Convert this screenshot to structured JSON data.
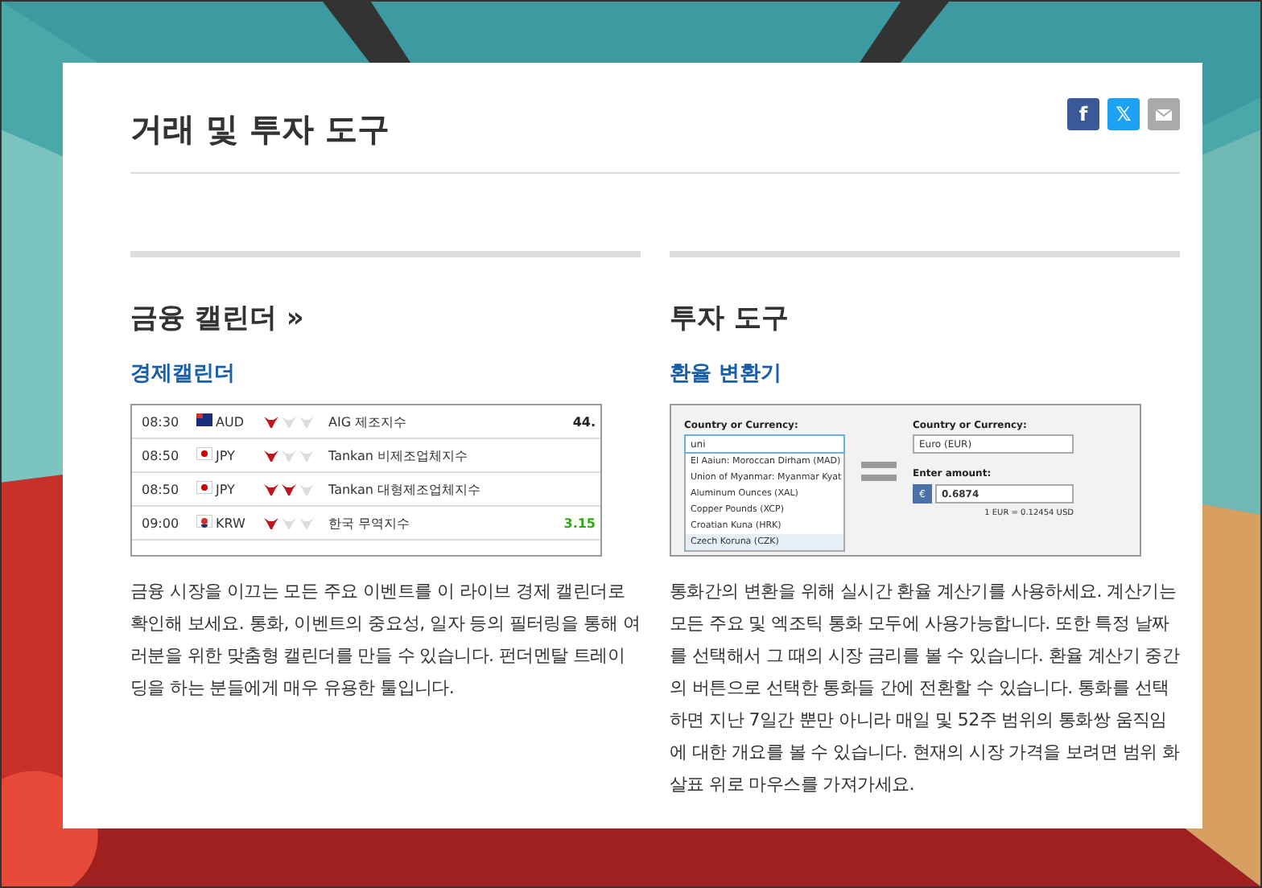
{
  "page": {
    "title": "거래 및 투자 도구"
  },
  "share": [
    {
      "kind": "facebook",
      "label": "f"
    },
    {
      "kind": "x",
      "label": "𝕏"
    },
    {
      "kind": "email"
    }
  ],
  "sections": [
    {
      "kind": "calendar",
      "heading": "금융 캘린더 »",
      "link": "경제캘린더",
      "preview": {
        "rows": [
          {
            "time": "08:30",
            "flag": {
              "kind": "au"
            },
            "currency": "AUD",
            "stars": 1,
            "event": "AIG 제조지수",
            "value": "44.",
            "color": "#222222"
          },
          {
            "time": "08:50",
            "flag": {
              "kind": "jp"
            },
            "currency": "JPY",
            "stars": 1,
            "event": "Tankan 비제조업체지수"
          },
          {
            "time": "08:50",
            "flag": {
              "kind": "jp"
            },
            "currency": "JPY",
            "stars": 2,
            "event": "Tankan 대형제조업체지수"
          },
          {
            "time": "09:00",
            "flag": {
              "kind": "kr"
            },
            "currency": "KRW",
            "stars": 1,
            "event": "한국 무역지수",
            "value": "3.15",
            "color": "#33aa11"
          }
        ]
      },
      "body": "금융 시장을 이끄는 모든 주요 이벤트를 이 라이브 경제 캘린더로 확인해 보세요. 통화, 이벤트의 중요성, 일자 등의 필터링을 통해 여러분을 위한 맞춤형 캘린더를 만들 수 있습니다. 펀더멘탈 트레이딩을 하는 분들에게 매우 유용한 툴입니다."
    },
    {
      "kind": "converter",
      "heading": "투자 도구",
      "link": "환율 변환기",
      "preview": {
        "from_label": "Country or Currency:",
        "from_value": "uni",
        "options": [
          {
            "text": "El Aaiun: Moroccan Dirham (MAD)",
            "selected": false
          },
          {
            "text": "Union of Myanmar: Myanmar Kyat",
            "selected": false
          },
          {
            "text": "Aluminum Ounces (XAL)",
            "selected": false
          },
          {
            "text": "Copper Pounds (XCP)",
            "selected": false
          },
          {
            "text": "Croatian Kuna (HRK)",
            "selected": false
          },
          {
            "text": "Czech Koruna (CZK)",
            "selected": true
          }
        ],
        "to_label": "Country or Currency:",
        "to_value": "Euro (EUR)",
        "amount_label": "Enter amount:",
        "currency_sign": "€",
        "amount": "0.6874",
        "rate": "1 EUR = 0.12454 USD"
      },
      "body": "통화간의 변환을 위해 실시간 환율 계산기를 사용하세요. 계산기는 모든 주요 및 엑조틱 통화 모두에 사용가능합니다. 또한 특정 날짜를 선택해서 그 때의 시장 금리를 볼 수 있습니다. 환율 계산기 중간의 버튼으로 선택한 통화들 간에 전환할 수 있습니다. 통화를 선택하면 지난 7일간 뿐만 아니라 매일 및 52주 범위의 통화쌍 움직임에 대한 개요를 볼 수 있습니다. 현재의 시장 가격을 보려면 범위 화살표 위로 마우스를 가져가세요."
    }
  ]
}
